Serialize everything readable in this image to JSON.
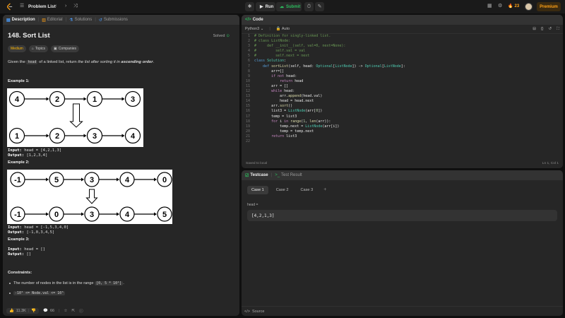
{
  "nav": {
    "problem_list": "Problem List",
    "run": "Run",
    "submit": "Submit",
    "streak": "23",
    "premium": "Premium"
  },
  "colors": {
    "accent": "#ffa116",
    "submit": "#2cbb5d",
    "medium": "#ffb800",
    "background": "#0f0f0f",
    "panel": "#262626"
  },
  "left_tabs": [
    "Description",
    "Editorial",
    "Solutions",
    "Submissions"
  ],
  "problem": {
    "title": "148. Sort List",
    "status": "Solved",
    "tags": {
      "difficulty": "Medium",
      "topics": "Topics",
      "companies": "Companies"
    },
    "statement": {
      "p1": "Given the ",
      "code": "head",
      "p2": " of a linked list, return ",
      "em": "the list after sorting it in ",
      "strong": "ascending order",
      "end": "."
    },
    "examples": [
      {
        "label": "Example 1:",
        "input_label": "Input:",
        "input": "head = [4,2,1,3]",
        "output_label": "Output:",
        "output": "[1,2,3,4]",
        "before": [
          "4",
          "2",
          "1",
          "3"
        ],
        "after": [
          "1",
          "2",
          "3",
          "4"
        ]
      },
      {
        "label": "Example 2:",
        "input_label": "Input:",
        "input": "head = [-1,5,3,4,0]",
        "output_label": "Output:",
        "output": "[-1,0,3,4,5]",
        "before": [
          "-1",
          "5",
          "3",
          "4",
          "0"
        ],
        "after": [
          "-1",
          "0",
          "3",
          "4",
          "5"
        ]
      },
      {
        "label": "Example 3:",
        "input_label": "Input:",
        "input": "head = []",
        "output_label": "Output:",
        "output": "[]"
      }
    ],
    "constraints_title": "Constraints:",
    "constraints": [
      {
        "text": "The number of nodes in the list is in the range ",
        "code": "[0, 5 * 10⁴]",
        "end": "."
      },
      {
        "text": "",
        "code": "-10⁵ <= Node.val <= 10⁵",
        "end": ""
      }
    ]
  },
  "left_footer": {
    "likes": "11.3K",
    "comments": "66"
  },
  "code_panel": {
    "title": "Code",
    "language": "Python3",
    "auto": "Auto",
    "saved": "Saved to local",
    "cursor": "Ln 1, Col 1",
    "lines": [
      "# Definition for singly-linked list.",
      "# class ListNode:",
      "#     def __init__(self, val=0, next=None):",
      "#         self.val = val",
      "#         self.next = next",
      "class Solution:",
      "    def sortList(self, head: Optional[ListNode]) -> Optional[ListNode]:",
      "        arr=[]",
      "        if not head:",
      "            return head",
      "        arr = []",
      "        while head:",
      "            arr.append(head.val)",
      "            head = head.next",
      "        arr.sort()",
      "        list3 = ListNode(arr[0])",
      "        temp = list3",
      "        for i in range(1, len(arr)):",
      "            temp.next = ListNode(arr[i])",
      "            temp = temp.next",
      "        return list3",
      ""
    ]
  },
  "test_panel": {
    "tabs": [
      "Testcase",
      "Test Result"
    ],
    "cases": [
      "Case 1",
      "Case 2",
      "Case 3"
    ],
    "param_label": "head =",
    "value": "[4,2,1,3]",
    "footer": "Source"
  }
}
